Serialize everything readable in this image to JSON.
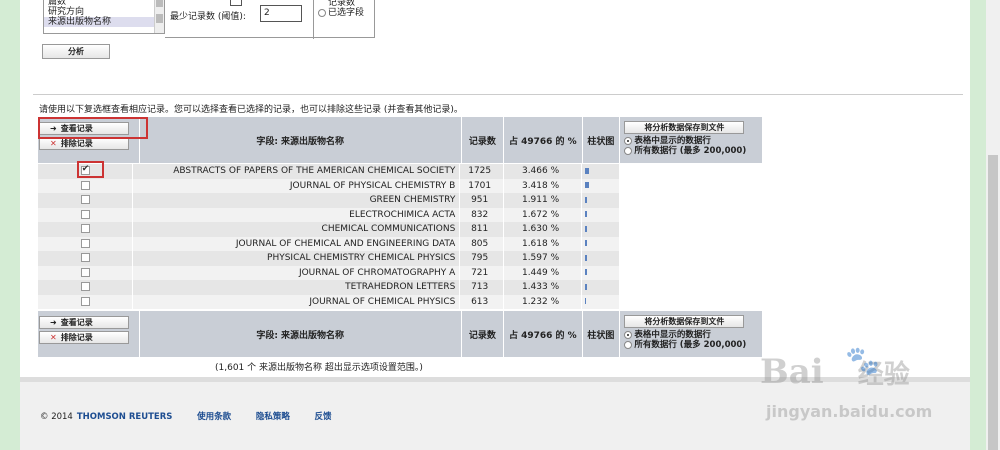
{
  "field_list": {
    "items": [
      "篇数",
      "研究方向",
      "来源出版物名称"
    ],
    "selected": "来源出版物名称"
  },
  "threshold": {
    "label": "最少记录数 (阈值):",
    "value": "2"
  },
  "top_radio": {
    "partial_label": "记录数",
    "label": "已选字段"
  },
  "analyze_label": "分析",
  "instructions": "请使用以下复选框查看相应记录。您可以选择查看已选择的记录，也可以排除这些记录 (并查看其他记录)。",
  "buttons": {
    "view": "查看记录",
    "exclude": "排除记录",
    "save": "将分析数据保存到文件"
  },
  "save_options": {
    "opt1": "表格中显示的数据行",
    "opt2": "所有数据行 (最多 200,000)"
  },
  "columns": {
    "field": "字段: 来源出版物名称",
    "count": "记录数",
    "pct": "占 49766 的 %",
    "chart": "柱状图"
  },
  "rows": [
    {
      "name": "ABSTRACTS OF PAPERS OF THE AMERICAN CHEMICAL SOCIETY",
      "count": "1725",
      "pct": "3.466 %",
      "checked": true
    },
    {
      "name": "JOURNAL OF PHYSICAL CHEMISTRY B",
      "count": "1701",
      "pct": "3.418 %",
      "checked": false
    },
    {
      "name": "GREEN CHEMISTRY",
      "count": "951",
      "pct": "1.911 %",
      "checked": false
    },
    {
      "name": "ELECTROCHIMICA ACTA",
      "count": "832",
      "pct": "1.672 %",
      "checked": false
    },
    {
      "name": "CHEMICAL COMMUNICATIONS",
      "count": "811",
      "pct": "1.630 %",
      "checked": false
    },
    {
      "name": "JOURNAL OF CHEMICAL AND ENGINEERING DATA",
      "count": "805",
      "pct": "1.618 %",
      "checked": false
    },
    {
      "name": "PHYSICAL CHEMISTRY CHEMICAL PHYSICS",
      "count": "795",
      "pct": "1.597 %",
      "checked": false
    },
    {
      "name": "JOURNAL OF CHROMATOGRAPHY A",
      "count": "721",
      "pct": "1.449 %",
      "checked": false
    },
    {
      "name": "TETRAHEDRON LETTERS",
      "count": "713",
      "pct": "1.433 %",
      "checked": false
    },
    {
      "name": "JOURNAL OF CHEMICAL PHYSICS",
      "count": "613",
      "pct": "1.232 %",
      "checked": false
    }
  ],
  "overflow_note": "(1,601 个 来源出版物名称 超出显示选项设置范围。)",
  "footer": {
    "copyright": "© 2014",
    "brand": "THOMSON REUTERS",
    "links": [
      "使用条款",
      "隐私策略",
      "反馈"
    ]
  },
  "watermark": {
    "text1": "Bai",
    "text1b": "经验",
    "text2": "jingyan.baidu.com"
  }
}
